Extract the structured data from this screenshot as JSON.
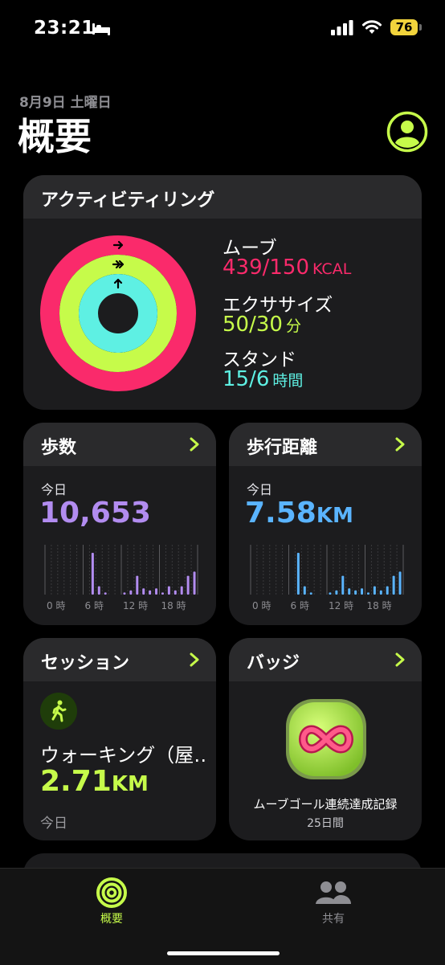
{
  "status_bar": {
    "time": "23:21",
    "battery": "76"
  },
  "header": {
    "date": "8月9日 土曜日",
    "title": "概要"
  },
  "activity": {
    "title": "アクティビティリング",
    "move": {
      "label": "ムーブ",
      "value": "439/150",
      "unit": "KCAL",
      "progress": 2.93,
      "color": "#fa2a6b"
    },
    "exercise": {
      "label": "エクササイズ",
      "value": "50/30",
      "unit": "分",
      "progress": 1.67,
      "color": "#c6fb4a"
    },
    "stand": {
      "label": "スタンド",
      "value": "15/6",
      "unit": "時間",
      "progress": 2.5,
      "color": "#5ef0e3"
    }
  },
  "steps": {
    "title": "歩数",
    "today": "今日",
    "value": "10,653",
    "color": "#b28cf0",
    "axis": [
      "0 時",
      "6 時",
      "12 時",
      "18 時"
    ],
    "hourly": [
      0,
      0,
      0,
      0,
      0,
      0,
      0,
      1.0,
      0.2,
      0.05,
      0,
      0,
      0.05,
      0.1,
      0.45,
      0.15,
      0.1,
      0.15,
      0.05,
      0.2,
      0.1,
      0.2,
      0.45,
      0.55
    ]
  },
  "distance": {
    "title": "歩行距離",
    "today": "今日",
    "value": "7.58",
    "unit": "KM",
    "color": "#5ab4ff",
    "axis": [
      "0 時",
      "6 時",
      "12 時",
      "18 時"
    ],
    "hourly": [
      0,
      0,
      0,
      0,
      0,
      0,
      0,
      1.0,
      0.2,
      0.05,
      0,
      0,
      0.05,
      0.1,
      0.45,
      0.15,
      0.1,
      0.15,
      0.05,
      0.2,
      0.1,
      0.2,
      0.45,
      0.55
    ]
  },
  "session": {
    "title": "セッション",
    "name": "ウォーキング（屋…",
    "value": "2.71",
    "unit": "KM",
    "date": "今日"
  },
  "badges": {
    "title": "バッジ",
    "name": "ムーブゴール連続達成記録",
    "sub": "25日間"
  },
  "tabbar": {
    "summary": {
      "label": "概要",
      "color": "#c6fb4a"
    },
    "sharing": {
      "label": "共有",
      "color": "#8e8e93"
    }
  }
}
